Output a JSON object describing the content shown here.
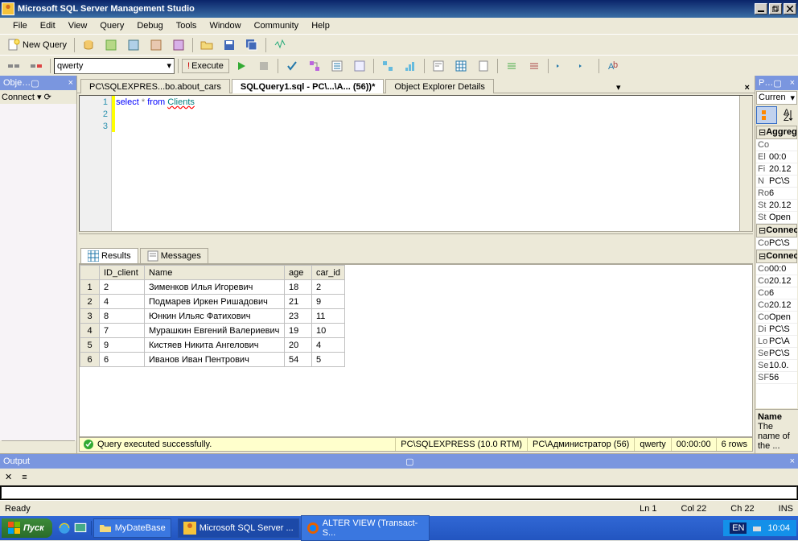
{
  "title": "Microsoft SQL Server Management Studio",
  "menu": [
    "File",
    "Edit",
    "View",
    "Query",
    "Debug",
    "Tools",
    "Window",
    "Community",
    "Help"
  ],
  "toolbar": {
    "newquery": "New Query"
  },
  "db": "qwerty",
  "execute": "Execute",
  "left": {
    "hdr": "Obje…",
    "connect": "Connect"
  },
  "tabs": [
    {
      "label": "PC\\SQLEXPRES...bo.about_cars"
    },
    {
      "label": "SQLQuery1.sql - PC\\...\\A... (56))*"
    },
    {
      "label": "Object Explorer Details"
    }
  ],
  "sql": {
    "select": "select",
    "star": "*",
    "from": "from",
    "table": "Clients"
  },
  "rtabs": {
    "results": "Results",
    "messages": "Messages"
  },
  "grid": {
    "cols": [
      "ID_client",
      "Name",
      "age",
      "car_id"
    ],
    "rows": [
      [
        "2",
        "Зименков Илья Игоревич",
        "18",
        "2"
      ],
      [
        "4",
        "Подмарев Иркен Ришадович",
        "21",
        "9"
      ],
      [
        "8",
        "Юнкин Ильяс Фатихович",
        "23",
        "11"
      ],
      [
        "7",
        "Мурашкин Евгений Валериевич",
        "19",
        "10"
      ],
      [
        "9",
        "Кистяев Никита Ангелович",
        "20",
        "4"
      ],
      [
        "6",
        "Иванов Иван Пентрович",
        "54",
        "5"
      ]
    ]
  },
  "status": {
    "msg": "Query executed successfully.",
    "conn": "PC\\SQLEXPRESS (10.0 RTM)",
    "user": "PC\\Администратор (56)",
    "db": "qwerty",
    "time": "00:00:00",
    "rows": "6 rows"
  },
  "right": {
    "hdr": "P… ",
    "cur": "Curren",
    "groups": {
      "agg": "Aggreg",
      "conn1": "Connec",
      "conn2": "Connec"
    },
    "props": [
      {
        "k": "Co",
        "v": ""
      },
      {
        "k": "El",
        "v": "00:0"
      },
      {
        "k": "Fi",
        "v": "20.12"
      },
      {
        "k": "N",
        "v": "PC\\S"
      },
      {
        "k": "Ro",
        "v": "6"
      },
      {
        "k": "St",
        "v": "20.12"
      },
      {
        "k": "St",
        "v": "Open"
      },
      {
        "k": "Co",
        "v": "PC\\S"
      },
      {
        "k": "Co",
        "v": "00:0"
      },
      {
        "k": "Co",
        "v": "20.12"
      },
      {
        "k": "Co",
        "v": "6"
      },
      {
        "k": "Co",
        "v": "20.12"
      },
      {
        "k": "Co",
        "v": "Open"
      },
      {
        "k": "Di",
        "v": "PC\\S"
      },
      {
        "k": "Lo",
        "v": "PC\\A"
      },
      {
        "k": "Se",
        "v": "PC\\S"
      },
      {
        "k": "Se",
        "v": "10.0."
      },
      {
        "k": "SF",
        "v": "56"
      }
    ],
    "desc": {
      "t": "Name",
      "d": "The name of the ..."
    }
  },
  "out": {
    "hdr": "Output"
  },
  "appstatus": {
    "ready": "Ready",
    "ln": "Ln 1",
    "col": "Col 22",
    "ch": "Ch 22",
    "ins": "INS"
  },
  "taskbar": {
    "start": "Пуск",
    "items": [
      {
        "label": "MyDateBase"
      },
      {
        "label": "Microsoft SQL Server ..."
      },
      {
        "label": "ALTER VIEW (Transact-S..."
      }
    ],
    "lang": "EN",
    "clock": "10:04"
  }
}
